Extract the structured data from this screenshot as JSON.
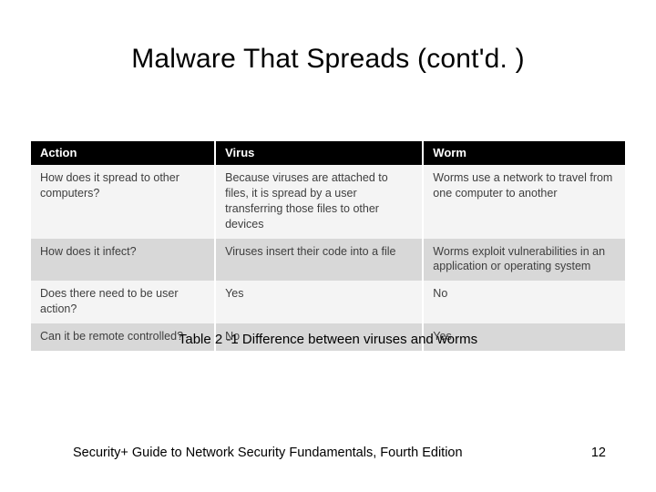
{
  "slide": {
    "title": "Malware That Spreads (cont'd. )",
    "caption": "Table 2 -1 Difference between viruses and worms",
    "footer_text": "Security+ Guide to Network Security Fundamentals, Fourth Edition",
    "page_number": "12"
  },
  "table": {
    "headers": {
      "action": "Action",
      "virus": "Virus",
      "worm": "Worm"
    },
    "rows": [
      {
        "action": "How does it spread to other computers?",
        "virus": "Because viruses are attached to files, it is spread by a user transferring those files to other devices",
        "worm": "Worms use a network to travel from one computer to another"
      },
      {
        "action": "How does it infect?",
        "virus": "Viruses insert their code into a file",
        "worm": "Worms exploit vulnerabilities in an application or operating system"
      },
      {
        "action": "Does there need to be user action?",
        "virus": "Yes",
        "worm": "No"
      },
      {
        "action": "Can it be remote controlled?",
        "virus": "No",
        "worm": "Yes"
      }
    ]
  }
}
